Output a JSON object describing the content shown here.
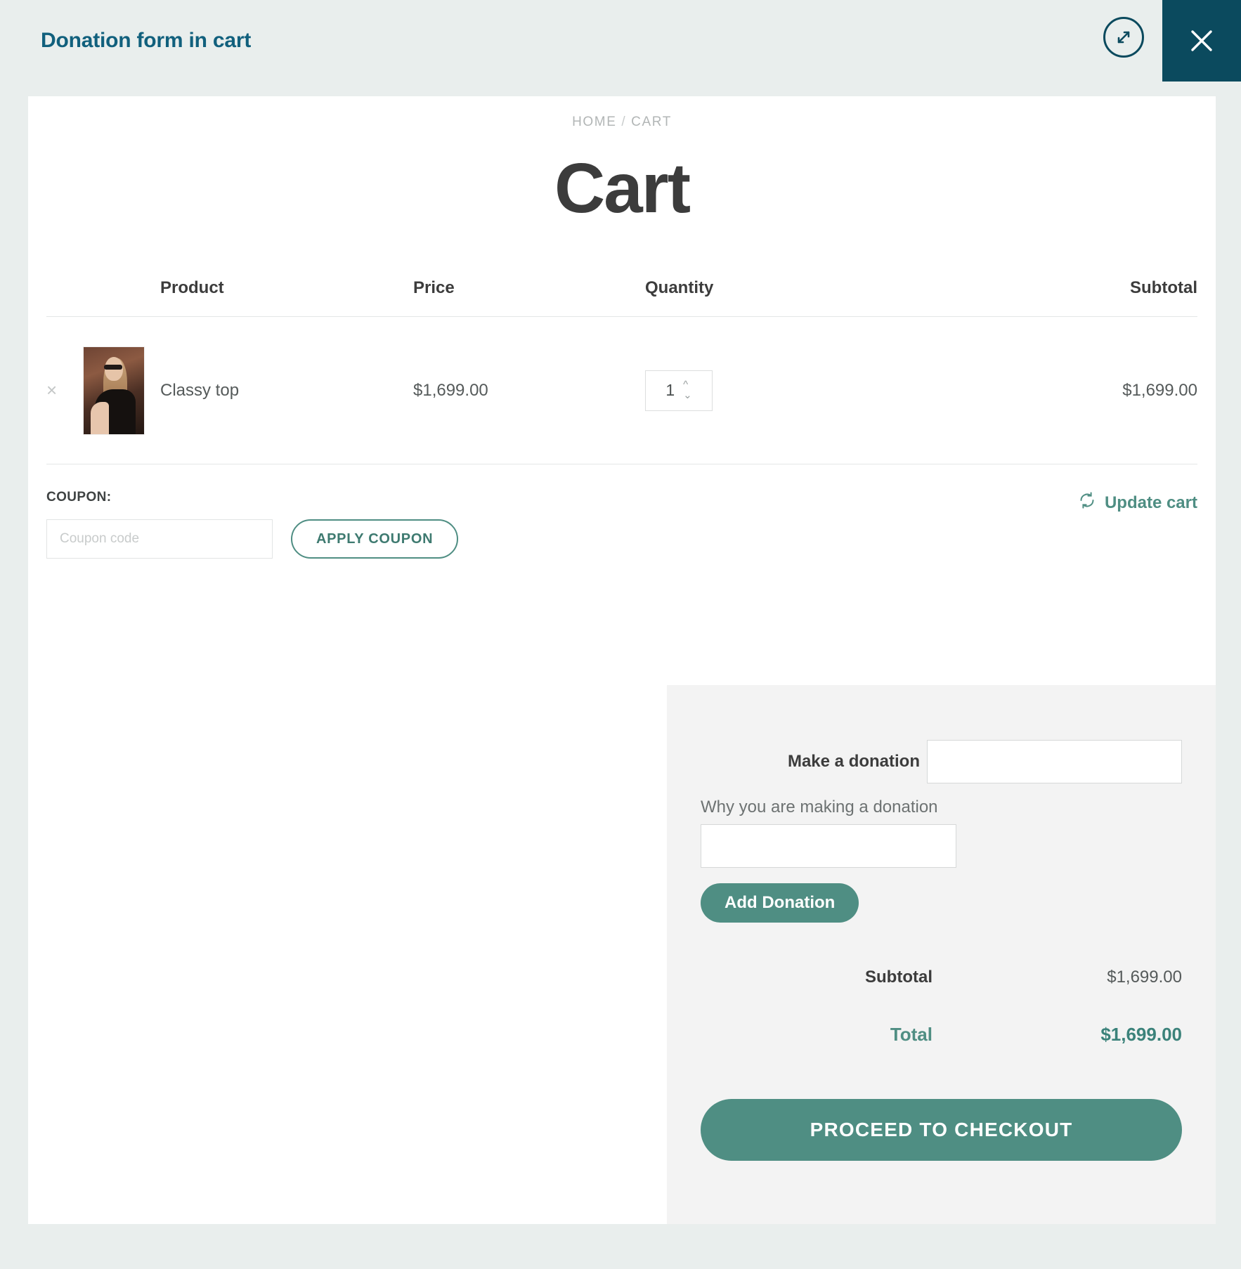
{
  "window": {
    "title": "Donation form in cart",
    "expand_icon": "expand-arrows-icon",
    "close_icon": "close-icon"
  },
  "page": {
    "breadcrumb": {
      "home": "HOME",
      "separator": "/",
      "current": "CART"
    },
    "title": "Cart"
  },
  "cart_table": {
    "headers": {
      "product": "Product",
      "price": "Price",
      "quantity": "Quantity",
      "subtotal": "Subtotal"
    },
    "rows": [
      {
        "remove_glyph": "×",
        "thumbnail_alt": "woman-wearing-sunglasses-and-black-top",
        "name": "Classy top",
        "price": "$1,699.00",
        "quantity": "1",
        "subtotal": "$1,699.00"
      }
    ]
  },
  "coupon": {
    "label": "COUPON:",
    "placeholder": "Coupon code",
    "value": "",
    "apply_label": "APPLY COUPON"
  },
  "update_cart": {
    "label": "Update cart",
    "icon": "refresh-icon"
  },
  "donation": {
    "amount_label": "Make a donation",
    "amount_value": "",
    "amount_placeholder": "",
    "reason_label": "Why you are making a donation",
    "reason_value": "",
    "reason_placeholder": "",
    "add_button_label": "Add Donation"
  },
  "totals": {
    "subtotal_label": "Subtotal",
    "subtotal_value": "$1,699.00",
    "total_label": "Total",
    "total_value": "$1,699.00",
    "checkout_label": "PROCEED TO CHECKOUT"
  },
  "colors": {
    "title_teal": "#11607d",
    "close_bg": "#0b4a5e",
    "accent_green": "#4f8e83",
    "panel_bg": "#f3f3f3",
    "chrome_bg": "#e9eeed"
  }
}
